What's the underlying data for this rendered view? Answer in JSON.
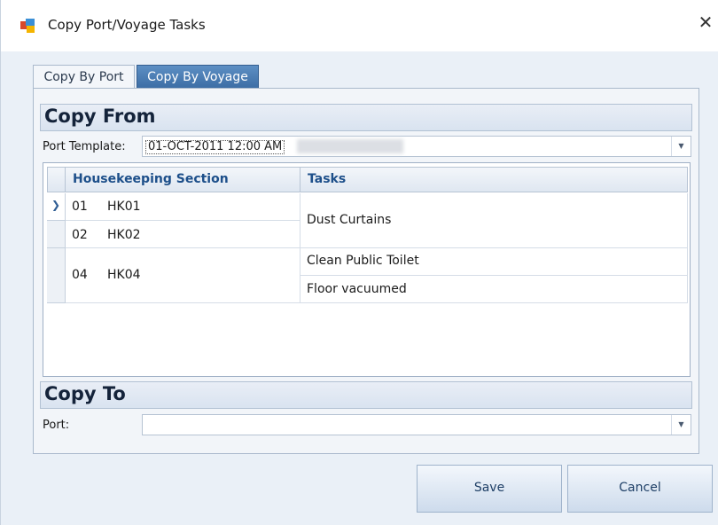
{
  "window": {
    "title": "Copy Port/Voyage Tasks",
    "close_glyph": "✕"
  },
  "tabs": [
    {
      "label": "Copy By Port"
    },
    {
      "label": "Copy By Voyage"
    }
  ],
  "copy_from": {
    "title": "Copy From",
    "port_template_label": "Port Template:",
    "port_template_value": "01-OCT-2011 12:00 AM"
  },
  "grid": {
    "columns": [
      "Housekeeping Section",
      "Tasks"
    ],
    "sections": [
      {
        "num": "01",
        "code": "HK01"
      },
      {
        "num": "02",
        "code": "HK02"
      },
      {
        "num": "04",
        "code": "HK04"
      }
    ],
    "tasks": [
      "Dust Curtains",
      "Clean Public Toilet",
      "Floor vacuumed"
    ]
  },
  "copy_to": {
    "title": "Copy To",
    "port_label": "Port:",
    "port_value": ""
  },
  "buttons": {
    "save": "Save",
    "cancel": "Cancel"
  },
  "colors": {
    "active_tab": "#4a7cb3",
    "header_text": "#1d4f8a"
  }
}
